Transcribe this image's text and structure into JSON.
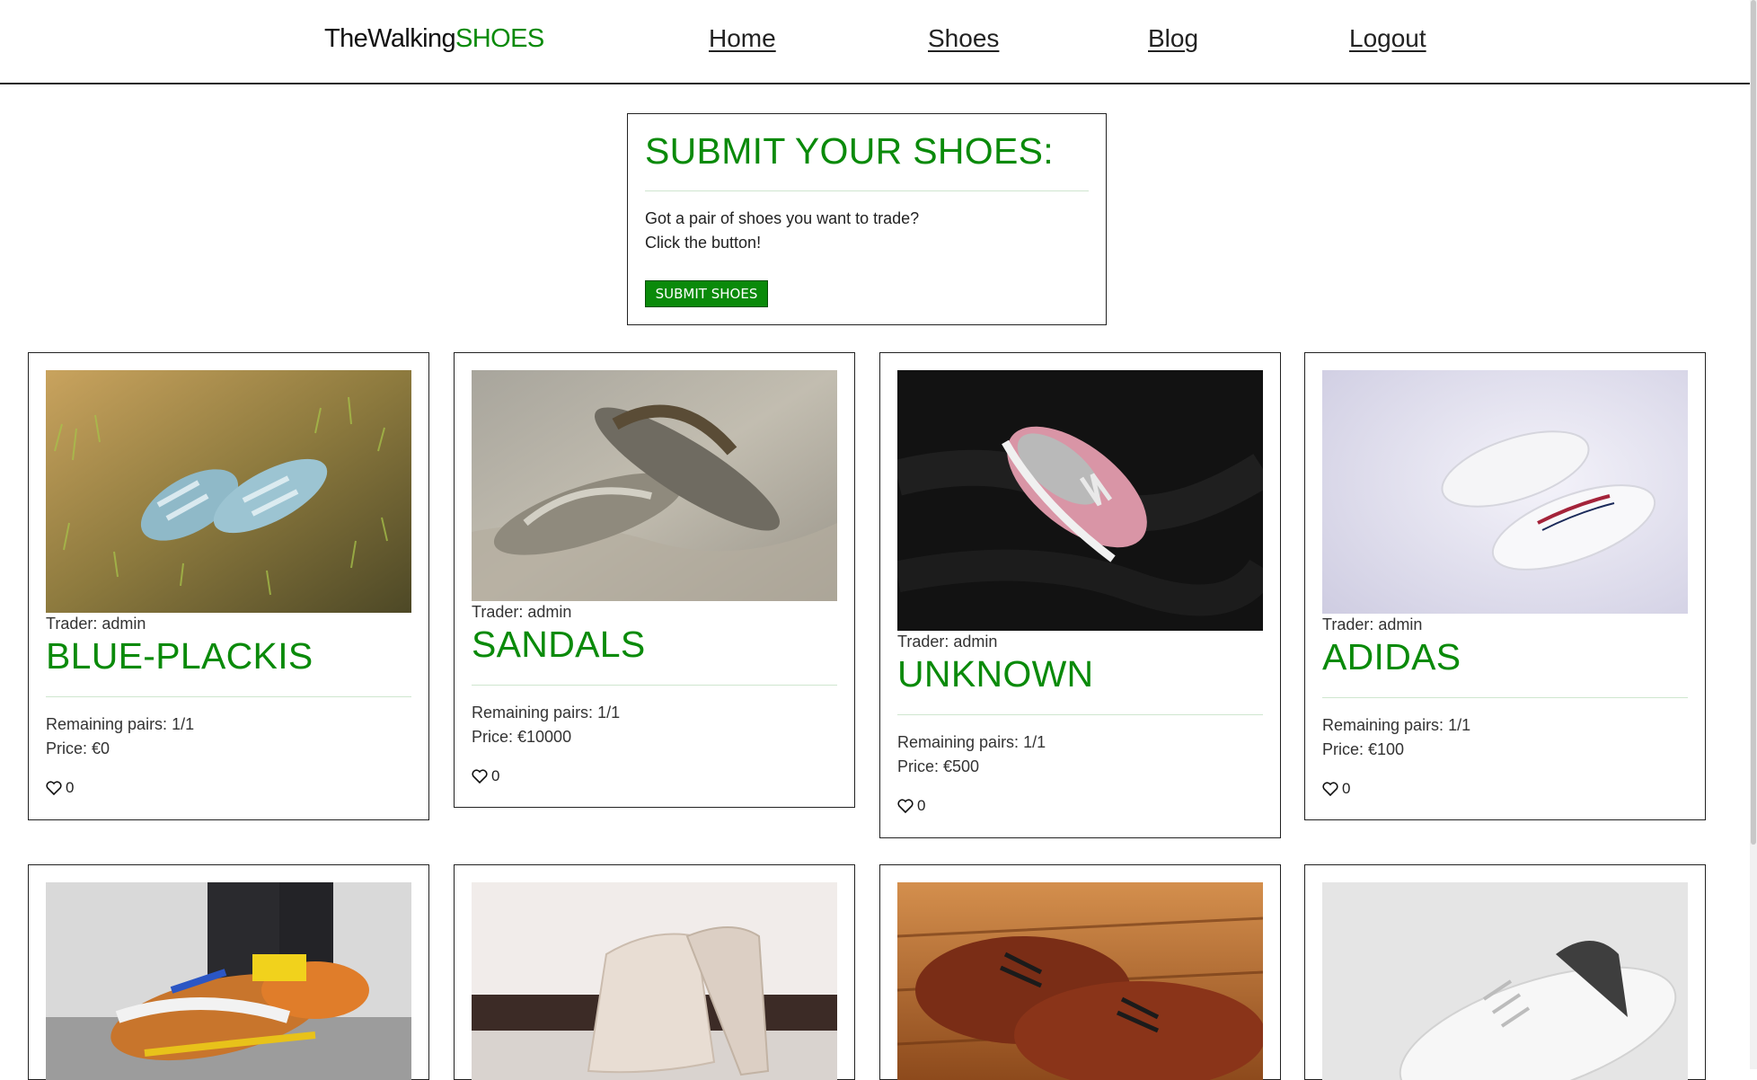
{
  "header": {
    "brand_main": "TheWalking",
    "brand_accent": "SHOES",
    "nav": {
      "home": "Home",
      "shoes": "Shoes",
      "blog": "Blog",
      "logout": "Logout"
    }
  },
  "submit": {
    "title": "SUBMIT YOUR SHOES:",
    "line1": "Got a pair of shoes you want to trade?",
    "line2": "Click the button!",
    "button": "SUBMIT SHOES"
  },
  "cards": [
    {
      "trader": "Trader: admin",
      "title": "BLUE-PLACKIS",
      "remaining": "Remaining pairs: 1/1",
      "price": "Price: €0",
      "likes": "0"
    },
    {
      "trader": "Trader: admin",
      "title": "SANDALS",
      "remaining": "Remaining pairs: 1/1",
      "price": "Price: €10000",
      "likes": "0"
    },
    {
      "trader": "Trader: admin",
      "title": "UNKNOWN",
      "remaining": "Remaining pairs: 1/1",
      "price": "Price: €500",
      "likes": "0"
    },
    {
      "trader": "Trader: admin",
      "title": "ADIDAS",
      "remaining": "Remaining pairs: 1/1",
      "price": "Price: €100",
      "likes": "0"
    }
  ],
  "colors": {
    "accent_green": "#0a8a0a",
    "border": "#222222"
  }
}
